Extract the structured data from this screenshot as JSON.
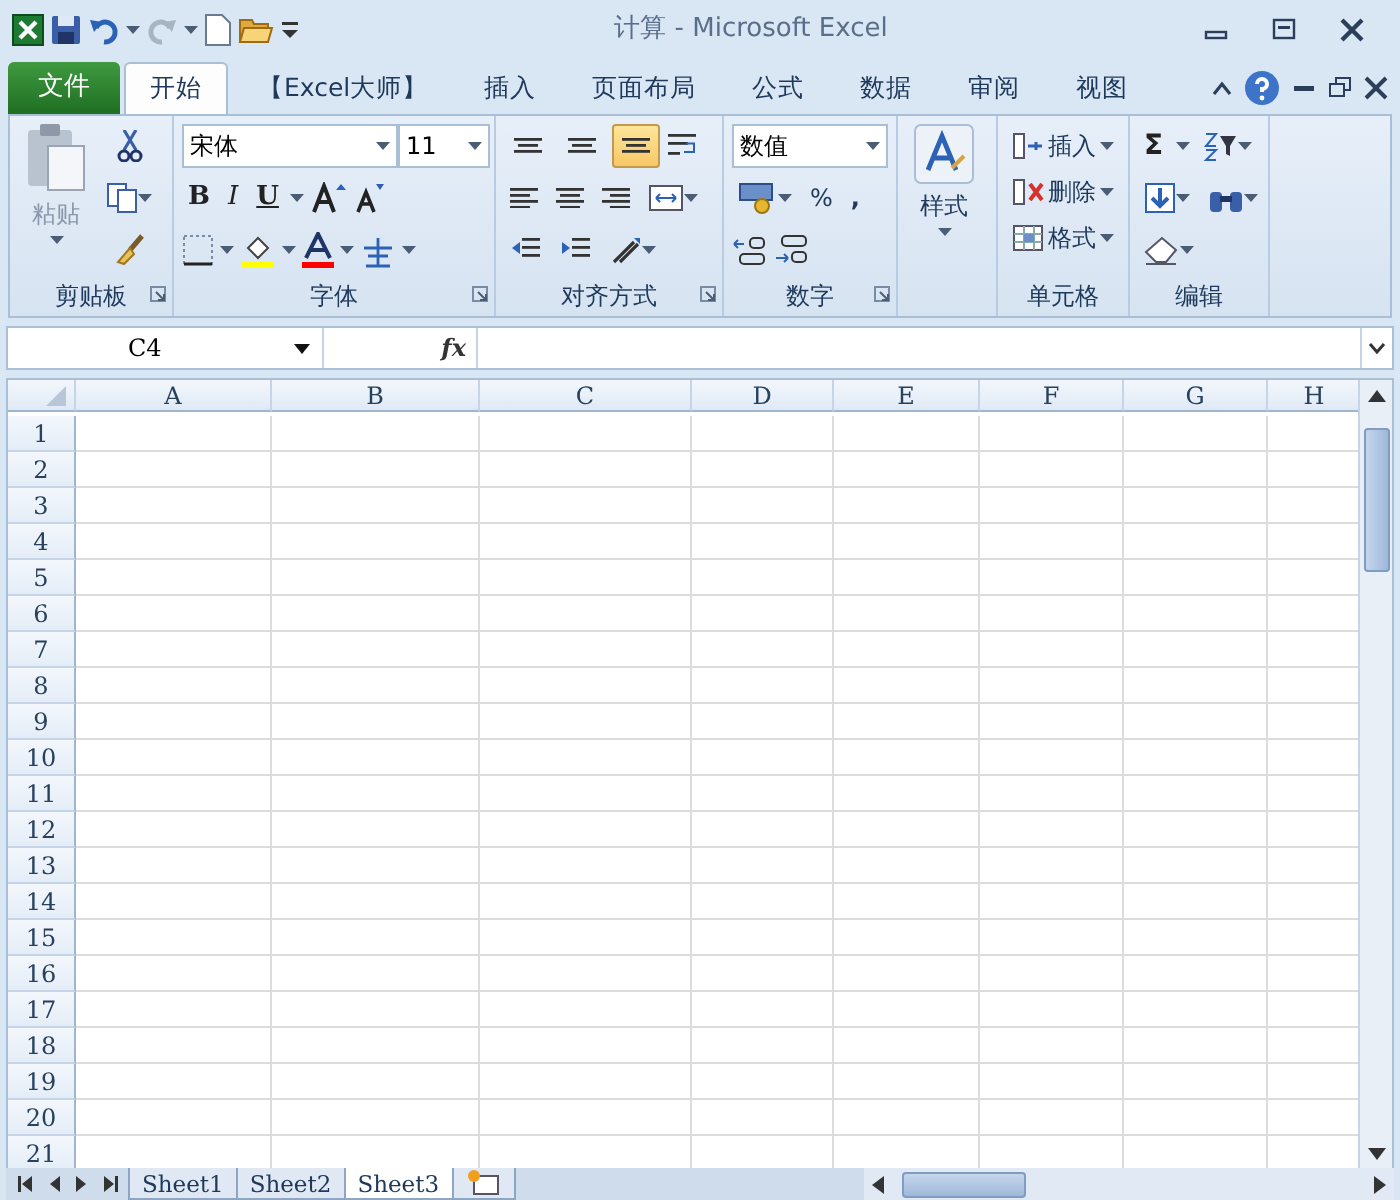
{
  "window": {
    "title": "计算 - Microsoft Excel"
  },
  "file_tab": {
    "label": "文件"
  },
  "tabs": [
    {
      "label": "开始",
      "selected": true
    },
    {
      "label": "【Excel大师】",
      "selected": false
    },
    {
      "label": "插入",
      "selected": false
    },
    {
      "label": "页面布局",
      "selected": false
    },
    {
      "label": "公式",
      "selected": false
    },
    {
      "label": "数据",
      "selected": false
    },
    {
      "label": "审阅",
      "selected": false
    },
    {
      "label": "视图",
      "selected": false
    }
  ],
  "ribbon": {
    "clipboard": {
      "paste": "粘贴",
      "label": "剪贴板"
    },
    "font": {
      "name": "宋体",
      "size": "11",
      "styles": [
        "B",
        "I",
        "U"
      ],
      "label": "字体"
    },
    "alignment": {
      "label": "对齐方式",
      "vertical": [
        {
          "selected": false
        },
        {
          "selected": false
        },
        {
          "selected": true
        }
      ]
    },
    "number": {
      "format": "数值",
      "percent": "%",
      "comma": ",",
      "label": "数字"
    },
    "styles": {
      "button": "样式"
    },
    "cells": {
      "commands": [
        "插入",
        "删除",
        "格式"
      ],
      "label": "单元格"
    },
    "editing": {
      "sum": "Σ",
      "label": "编辑"
    }
  },
  "formula_bar": {
    "name_box": "C4",
    "fx": "fx"
  },
  "columns": [
    "A",
    "B",
    "C",
    "D",
    "E",
    "F",
    "G",
    "H"
  ],
  "rows": [
    "1",
    "2",
    "3",
    "4",
    "5",
    "6",
    "7",
    "8",
    "9",
    "10",
    "11",
    "12",
    "13",
    "14",
    "15",
    "16",
    "17",
    "18",
    "19",
    "20",
    "21"
  ],
  "sheets": [
    {
      "label": "Sheet1",
      "selected": false
    },
    {
      "label": "Sheet2",
      "selected": false
    },
    {
      "label": "Sheet3",
      "selected": true
    }
  ]
}
